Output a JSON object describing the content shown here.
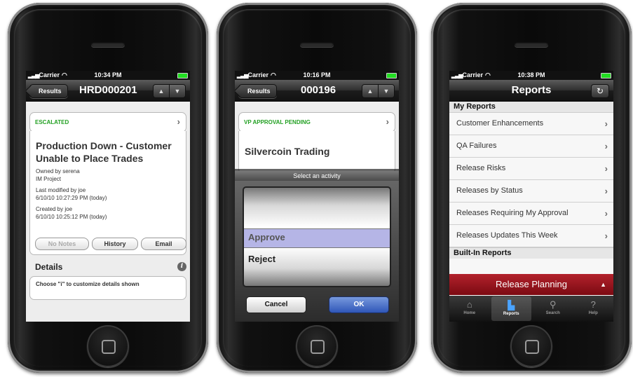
{
  "status": {
    "carrier": "Carrier",
    "times": [
      "10:34 PM",
      "10:16 PM",
      "10:38 PM"
    ]
  },
  "phone1": {
    "back": "Results",
    "title": "HRD000201",
    "status_label": "ESCALATED",
    "record_title_line1": "Production Down - Customer",
    "record_title_line2": "Unable to Place Trades",
    "owned": "Owned by serena",
    "project": "IM Project",
    "modified_by": "Last modified by joe",
    "modified_at": "6/10/10 10:27:29 PM (today)",
    "created_by": "Created by joe",
    "created_at": "6/10/10 10:25:12 PM (today)",
    "buttons": {
      "notes": "No Notes",
      "history": "History",
      "email": "Email"
    },
    "details_header": "Details",
    "details_hint": "Choose \"i\" to customize details shown"
  },
  "phone2": {
    "back": "Results",
    "title": "000196",
    "status_label": "VP APPROVAL PENDING",
    "company": "Silvercoin Trading",
    "picker_title": "Select an activity",
    "options": [
      "Approve",
      "Reject"
    ],
    "selected_option": "Approve",
    "cancel": "Cancel",
    "ok": "OK"
  },
  "phone3": {
    "title": "Reports",
    "my_reports_header": "My Reports",
    "reports": [
      "Customer Enhancements",
      "QA Failures",
      "Release Risks",
      "Releases by Status",
      "Releases Requiring My Approval",
      "Releases Updates This Week"
    ],
    "builtin_header": "Built-In Reports",
    "release_planning": "Release Planning",
    "tabs": [
      {
        "label": "Home",
        "icon": "home-icon"
      },
      {
        "label": "Reports",
        "icon": "reports-icon"
      },
      {
        "label": "Search",
        "icon": "search-icon"
      },
      {
        "label": "Help",
        "icon": "help-icon"
      }
    ],
    "selected_tab": "Reports"
  },
  "colors": {
    "status_green": "#22a022",
    "ok_blue": "#2f56b8",
    "release_red": "#9b141d"
  }
}
